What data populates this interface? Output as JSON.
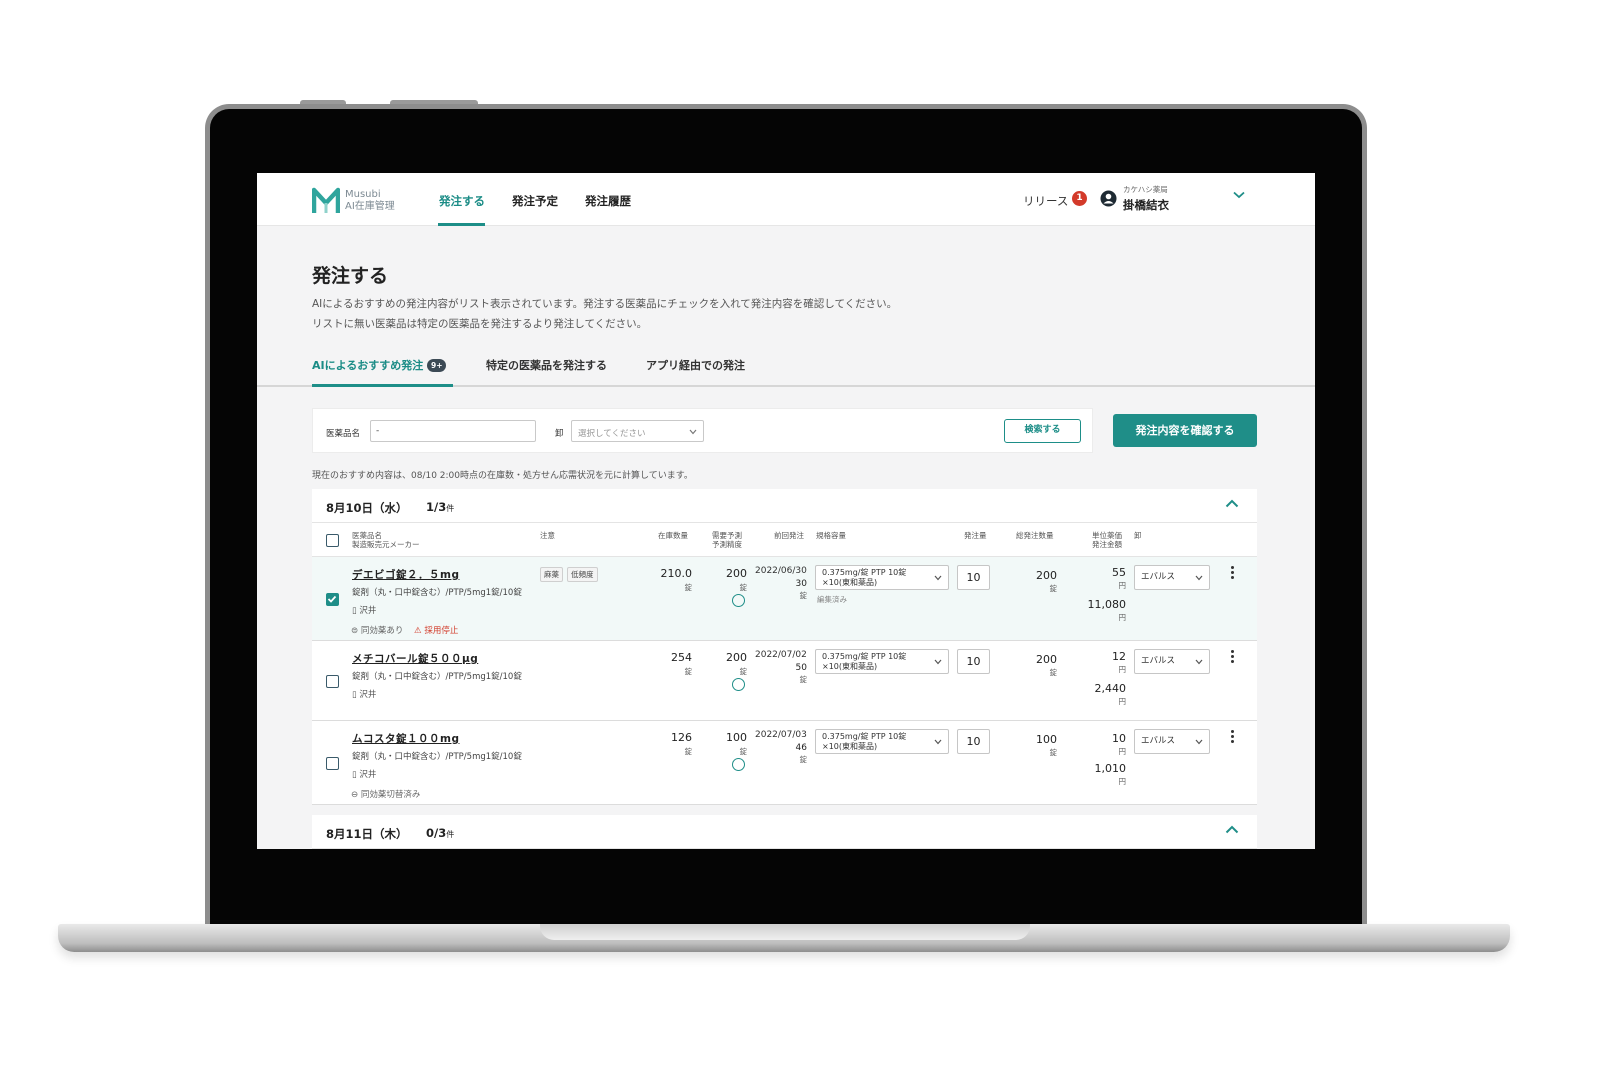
{
  "brand": {
    "name": "Musubi",
    "product": "AI在庫管理",
    "accent": "#1f8e88"
  },
  "nav": {
    "items": [
      "発注する",
      "発注予定",
      "発注履歴"
    ],
    "active": 0
  },
  "header": {
    "release_label": "リリース",
    "release_badge": "1",
    "org": "カケハシ薬局",
    "user": "掛橋結衣"
  },
  "page": {
    "title": "発注する",
    "desc1": "AIによるおすすめの発注内容がリスト表示されています。発注する医薬品にチェックを入れて発注内容を確認してください。",
    "desc2": "リストに無い医薬品は特定の医薬品を発注するより発注してください。"
  },
  "tabs": [
    {
      "label": "AIによるおすすめ発注",
      "badge": "9+"
    },
    {
      "label": "特定の医薬品を発注する"
    },
    {
      "label": "アプリ経由での発注"
    }
  ],
  "filter": {
    "drug_label": "医薬品名",
    "drug_value": "-",
    "wholesaler_label": "卸",
    "wholesaler_placeholder": "選択してください",
    "search_button": "検索する"
  },
  "confirm_button": "発注内容を確認する",
  "note": "現在のおすすめ内容は、08/10 2:00時点の在庫数・処方せん応需状況を元に計算しています。",
  "columns": {
    "name": "医薬品名",
    "maker": "製造販売元メーカー",
    "caution": "注意",
    "stock": "在庫数量",
    "forecast1": "需要予測",
    "forecast2": "予測精度",
    "last_order": "前回発注",
    "package": "規格容量",
    "order_qty": "発注量",
    "total_qty": "総発注数量",
    "unit_price": "単位薬価",
    "amount": "発注金額",
    "wholesaler": "卸"
  },
  "groups": [
    {
      "date": "8月10日（水）",
      "count": "1/3",
      "count_unit": "件"
    },
    {
      "date": "8月11日（木）",
      "count": "0/3",
      "count_unit": "件"
    }
  ],
  "rows": [
    {
      "checked": true,
      "name": "デエビゴ錠２．５mg",
      "spec": "錠剤（丸・口中錠含む）/PTP/5mg1錠/10錠",
      "maker": "沢井",
      "chips": [
        "麻薬",
        "低頻度"
      ],
      "tags": [
        "同効薬あり"
      ],
      "alert": "採用停止",
      "stock": "210.0",
      "stock_unit": "錠",
      "forecast": "200",
      "forecast_unit": "錠",
      "last_date": "2022/06/30",
      "last_qty": "30",
      "last_unit": "錠",
      "package1": "0.375mg/錠 PTP 10錠",
      "package2": "×10(東和薬品)",
      "edited": "編集済み",
      "qty": "10",
      "total": "200",
      "total_unit": "錠",
      "price": "55",
      "price_unit": "円",
      "amount": "11,080",
      "amount_unit": "円",
      "vendor": "エバルス"
    },
    {
      "checked": false,
      "name": "メチコバール錠５００μg",
      "spec": "錠剤（丸・口中錠含む）/PTP/5mg1錠/10錠",
      "maker": "沢井",
      "chips": [],
      "tags": [],
      "alert": "",
      "stock": "254",
      "stock_unit": "錠",
      "forecast": "200",
      "forecast_unit": "錠",
      "last_date": "2022/07/02",
      "last_qty": "50",
      "last_unit": "錠",
      "package1": "0.375mg/錠 PTP 10錠",
      "package2": "×10(東和薬品)",
      "edited": "",
      "qty": "10",
      "total": "200",
      "total_unit": "錠",
      "price": "12",
      "price_unit": "円",
      "amount": "2,440",
      "amount_unit": "円",
      "vendor": "エバルス"
    },
    {
      "checked": false,
      "name": "ムコスタ錠１００mg",
      "spec": "錠剤（丸・口中錠含む）/PTP/5mg1錠/10錠",
      "maker": "沢井",
      "chips": [],
      "tags": [
        "同効薬切替済み"
      ],
      "alert": "",
      "stock": "126",
      "stock_unit": "錠",
      "forecast": "100",
      "forecast_unit": "錠",
      "last_date": "2022/07/03",
      "last_qty": "46",
      "last_unit": "錠",
      "package1": "0.375mg/錠 PTP 10錠",
      "package2": "×10(東和薬品)",
      "edited": "",
      "qty": "10",
      "total": "100",
      "total_unit": "錠",
      "price": "10",
      "price_unit": "円",
      "amount": "1,010",
      "amount_unit": "円",
      "vendor": "エバルス"
    }
  ]
}
